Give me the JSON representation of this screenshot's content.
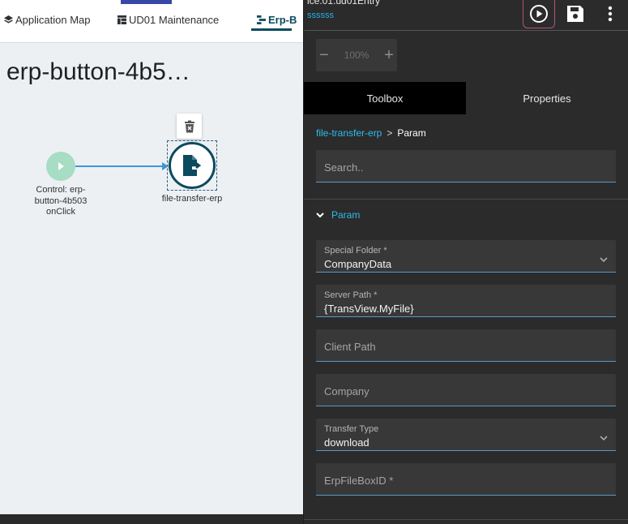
{
  "left": {
    "tabs": [
      {
        "label": "Application Map",
        "icon": "layers-icon"
      },
      {
        "label": "UD01 Maintenance",
        "icon": "table-icon"
      },
      {
        "label": "Erp-B",
        "icon": "flow-icon"
      }
    ],
    "canvas_title": "erp-button-4b5…",
    "nodes": {
      "trigger_label_lines": [
        "Control: erp-",
        "button-4b503",
        "onClick"
      ],
      "erp_label": "file-transfer-erp"
    },
    "colors": {
      "accent": "#0b4a5f",
      "trigger": "#a7dcc5",
      "edge": "#3f95d8"
    }
  },
  "right": {
    "header": {
      "path": "ice.01.ud01Entry",
      "subtitle": "ssssss"
    },
    "zoom": {
      "minus": "−",
      "value": "100%",
      "plus": "+"
    },
    "tabs": [
      {
        "label": "Toolbox",
        "active": true
      },
      {
        "label": "Properties",
        "active": false
      }
    ],
    "breadcrumb": {
      "link": "file-transfer-erp",
      "separator": ">",
      "current": "Param"
    },
    "search": {
      "placeholder": "Search.."
    },
    "section": {
      "title": "Param"
    },
    "fields": [
      {
        "label": "Special Folder *",
        "value": "CompanyData",
        "type": "select"
      },
      {
        "label": "Server Path *",
        "value": "{TransView.MyFile}",
        "type": "text"
      },
      {
        "label": "",
        "placeholder": "Client Path",
        "type": "text"
      },
      {
        "label": "",
        "placeholder": "Company",
        "type": "text"
      },
      {
        "label": "Transfer Type",
        "value": "download",
        "type": "select"
      },
      {
        "label": "",
        "placeholder": "ErpFileBoxID *",
        "type": "text"
      }
    ],
    "colors": {
      "link": "#2dbcf0",
      "run_border": "#b0537f"
    }
  }
}
